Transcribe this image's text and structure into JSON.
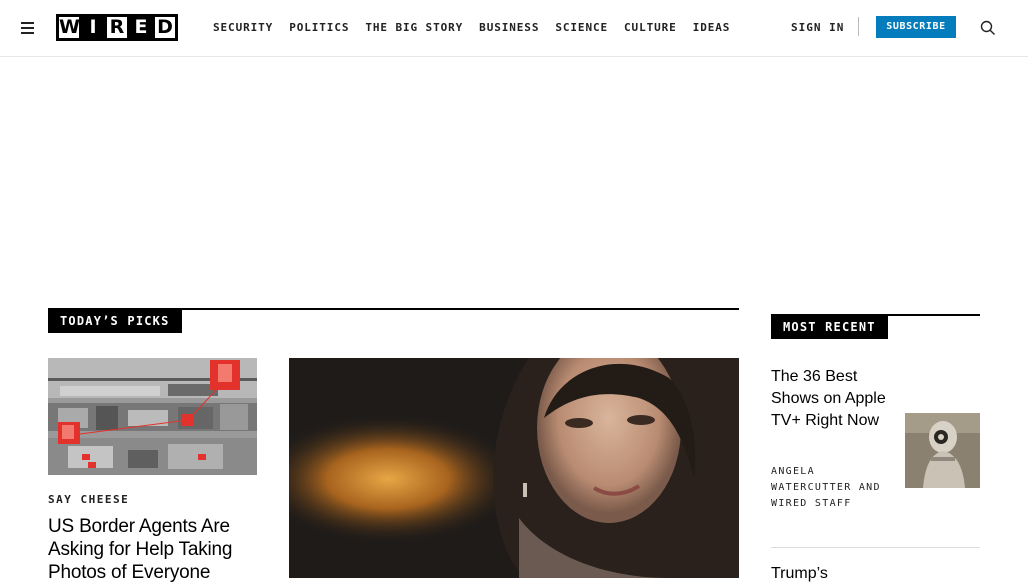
{
  "header": {
    "logo_letters": [
      "W",
      "I",
      "R",
      "E",
      "D"
    ],
    "nav": [
      "SECURITY",
      "POLITICS",
      "THE BIG STORY",
      "BUSINESS",
      "SCIENCE",
      "CULTURE",
      "IDEAS"
    ],
    "sign_in": "SIGN IN",
    "subscribe": "SUBSCRIBE",
    "icons": [
      "menu-icon",
      "search-icon"
    ]
  },
  "todays_picks": {
    "label": "TODAY’S PICKS",
    "story1": {
      "kicker": "SAY CHEESE",
      "headline": "US Border Agents Are Asking for Help Taking Photos of Everyone"
    }
  },
  "most_recent": {
    "label": "MOST RECENT",
    "item1": {
      "headline": "The 36 Best Shows on Apple TV+ Right Now",
      "byline": "ANGELA WATERCUTTER AND WIRED STAFF"
    },
    "item2": {
      "headline": "Trump’s"
    }
  },
  "colors": {
    "subscribe": "#057dbc",
    "black": "#000000"
  }
}
